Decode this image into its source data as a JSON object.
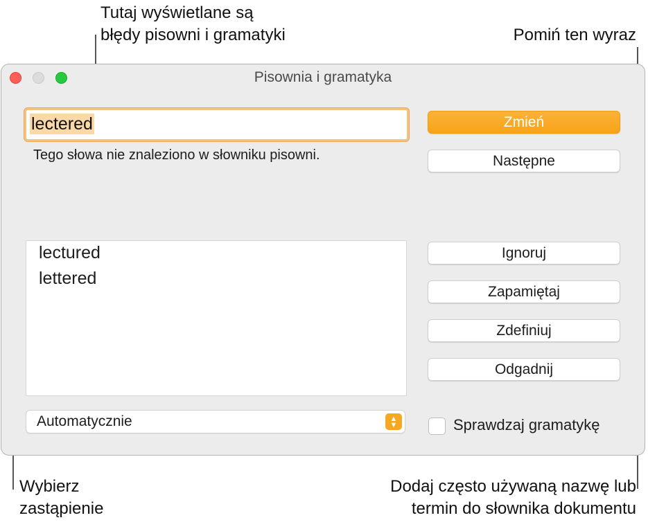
{
  "callouts": {
    "spelling_errors": [
      "Tutaj wyświetlane są",
      "błędy pisowni i gramatyki"
    ],
    "skip_word": "Pomiń ten wyraz",
    "choose_replacement": [
      "Wybierz",
      "zastąpienie"
    ],
    "add_term": [
      "Dodaj często używaną nazwę lub",
      "termin do słownika dokumentu"
    ]
  },
  "window": {
    "title": "Pisownia i gramatyka",
    "misspelled_word": "lectered",
    "message": "Tego słowa nie znaleziono w słowniku pisowni.",
    "suggestions": [
      "lectured",
      "lettered"
    ],
    "language_select": "Automatycznie",
    "buttons": {
      "change": "Zmień",
      "next": "Następne",
      "ignore": "Ignoruj",
      "learn": "Zapamiętaj",
      "define": "Zdefiniuj",
      "guess": "Odgadnij"
    },
    "check_grammar": {
      "label": "Sprawdzaj gramatykę",
      "checked": false
    }
  },
  "colors": {
    "accent": "#f7a823",
    "close": "#ff5f57",
    "zoom": "#28c840"
  },
  "icons": {
    "stepper": "up-down-chevron-icon"
  }
}
